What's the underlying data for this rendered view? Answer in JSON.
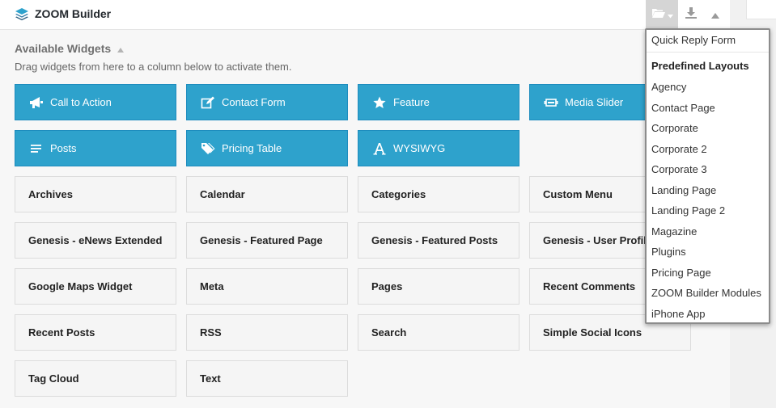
{
  "header": {
    "title": "ZOOM Builder",
    "icons": {
      "logo": "layers-icon",
      "open": "folder-open-icon",
      "dropdown": "caret-down-icon",
      "download": "download-icon",
      "collapse": "triangle-up-icon"
    }
  },
  "section": {
    "title": "Available Widgets",
    "description": "Drag widgets from here to a column below to activate them."
  },
  "widgets": {
    "featured": [
      {
        "label": "Call to Action",
        "icon": "megaphone-icon"
      },
      {
        "label": "Contact Form",
        "icon": "edit-icon"
      },
      {
        "label": "Feature",
        "icon": "star-icon"
      },
      {
        "label": "Media Slider",
        "icon": "slider-icon"
      },
      {
        "label": "Posts",
        "icon": "lines-icon"
      },
      {
        "label": "Pricing Table",
        "icon": "tags-icon"
      },
      {
        "label": "WYSIWYG",
        "icon": "text-a-icon"
      }
    ],
    "standard": [
      "Archives",
      "Calendar",
      "Categories",
      "Custom Menu",
      "Genesis - eNews Extended",
      "Genesis - Featured Page",
      "Genesis - Featured Posts",
      "Genesis - User Profile",
      "Google Maps Widget",
      "Meta",
      "Pages",
      "Recent Comments",
      "Recent Posts",
      "RSS",
      "Search",
      "Simple Social Icons",
      "Tag Cloud",
      "Text"
    ]
  },
  "dropdown": {
    "top_item": "Quick Reply Form",
    "header": "Predefined Layouts",
    "items": [
      "Agency",
      "Contact Page",
      "Corporate",
      "Corporate 2",
      "Corporate 3",
      "Landing Page",
      "Landing Page 2",
      "Magazine",
      "Plugins",
      "Pricing Page",
      "ZOOM Builder Modules",
      "iPhone App"
    ]
  },
  "colors": {
    "accent": "#2ea2cc",
    "accent_border": "#1e8cbe",
    "widget_grey": "#f5f5f5"
  }
}
